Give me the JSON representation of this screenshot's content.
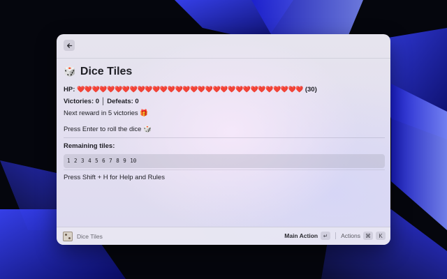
{
  "wallpaper": {
    "colors": [
      "#05060d",
      "#1b1fd1",
      "#3a45ff",
      "#7d8cff",
      "#0d0f3a"
    ]
  },
  "window": {
    "back_icon": "arrow-left-icon",
    "title_emoji": "🎲",
    "title": "Dice Tiles",
    "hp": {
      "label": "HP:",
      "hearts": "❤️❤️❤️❤️❤️❤️❤️❤️❤️❤️❤️❤️❤️❤️❤️❤️❤️❤️❤️❤️❤️❤️❤️❤️❤️❤️❤️❤️❤️❤️",
      "count": "(30)"
    },
    "victories_label": "Victories:",
    "victories": "0",
    "separator": "│",
    "defeats_label": "Defeats:",
    "defeats": "0",
    "reward_text": "Next reward in 5 victories",
    "reward_emoji": "🎁",
    "enter_text": "Press Enter to roll the dice",
    "enter_emoji": "🎲",
    "remaining_label": "Remaining tiles:",
    "tiles": "1 2 3 4 5 6 7 8 9 10",
    "help_text": "Press Shift + H for Help and Rules"
  },
  "footer": {
    "app_name": "Dice Tiles",
    "main_action": "Main Action",
    "enter_key": "↵",
    "actions": "Actions",
    "cmd_key": "⌘",
    "k_key": "K"
  }
}
